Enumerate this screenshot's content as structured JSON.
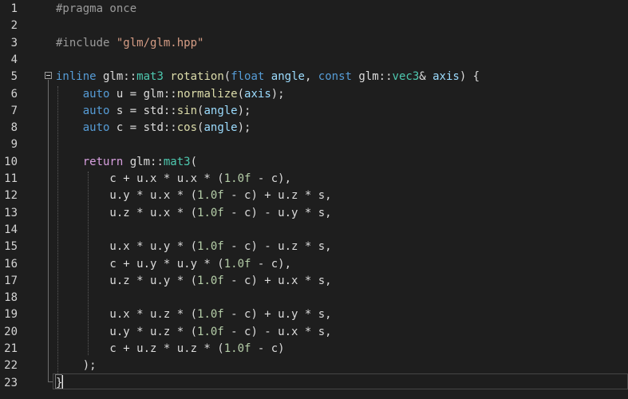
{
  "colors": {
    "background": "#1e1e1e",
    "default": "#dcdcdc",
    "preprocessor": "#9b9b9b",
    "string": "#d69d85",
    "keyword": "#569cd6",
    "control": "#d8a0df",
    "type": "#4ec9b0",
    "function": "#dcdcaa",
    "parameter": "#9cdcfe",
    "number": "#b5cea8"
  },
  "editor": {
    "lines": [
      {
        "n": "1",
        "tokens": [
          {
            "t": "#pragma once",
            "c": "preprocessor"
          }
        ]
      },
      {
        "n": "2",
        "tokens": []
      },
      {
        "n": "3",
        "tokens": [
          {
            "t": "#include ",
            "c": "preprocessor"
          },
          {
            "t": "\"glm/glm.hpp\"",
            "c": "string"
          }
        ]
      },
      {
        "n": "4",
        "tokens": []
      },
      {
        "n": "5",
        "tokens": [
          {
            "t": "inline",
            "c": "keyword"
          },
          {
            "t": " glm::",
            "c": "default"
          },
          {
            "t": "mat3",
            "c": "type"
          },
          {
            "t": " ",
            "c": "default"
          },
          {
            "t": "rotation",
            "c": "function"
          },
          {
            "t": "(",
            "c": "default"
          },
          {
            "t": "float",
            "c": "keyword"
          },
          {
            "t": " ",
            "c": "default"
          },
          {
            "t": "angle",
            "c": "parameter"
          },
          {
            "t": ", ",
            "c": "default"
          },
          {
            "t": "const",
            "c": "keyword"
          },
          {
            "t": " glm::",
            "c": "default"
          },
          {
            "t": "vec3",
            "c": "type"
          },
          {
            "t": "& ",
            "c": "default"
          },
          {
            "t": "axis",
            "c": "parameter"
          },
          {
            "t": ") {",
            "c": "default"
          }
        ]
      },
      {
        "n": "6",
        "tokens": [
          {
            "t": "    ",
            "c": "default"
          },
          {
            "t": "auto",
            "c": "keyword"
          },
          {
            "t": " u = glm::",
            "c": "default"
          },
          {
            "t": "normalize",
            "c": "function"
          },
          {
            "t": "(",
            "c": "default"
          },
          {
            "t": "axis",
            "c": "parameter"
          },
          {
            "t": ");",
            "c": "default"
          }
        ]
      },
      {
        "n": "7",
        "tokens": [
          {
            "t": "    ",
            "c": "default"
          },
          {
            "t": "auto",
            "c": "keyword"
          },
          {
            "t": " s = std::",
            "c": "default"
          },
          {
            "t": "sin",
            "c": "function"
          },
          {
            "t": "(",
            "c": "default"
          },
          {
            "t": "angle",
            "c": "parameter"
          },
          {
            "t": ");",
            "c": "default"
          }
        ]
      },
      {
        "n": "8",
        "tokens": [
          {
            "t": "    ",
            "c": "default"
          },
          {
            "t": "auto",
            "c": "keyword"
          },
          {
            "t": " c = std::",
            "c": "default"
          },
          {
            "t": "cos",
            "c": "function"
          },
          {
            "t": "(",
            "c": "default"
          },
          {
            "t": "angle",
            "c": "parameter"
          },
          {
            "t": ");",
            "c": "default"
          }
        ]
      },
      {
        "n": "9",
        "tokens": []
      },
      {
        "n": "10",
        "tokens": [
          {
            "t": "    ",
            "c": "default"
          },
          {
            "t": "return",
            "c": "control"
          },
          {
            "t": " glm::",
            "c": "default"
          },
          {
            "t": "mat3",
            "c": "type"
          },
          {
            "t": "(",
            "c": "default"
          }
        ]
      },
      {
        "n": "11",
        "tokens": [
          {
            "t": "        c + u.x * u.x * (",
            "c": "default"
          },
          {
            "t": "1.0f",
            "c": "number"
          },
          {
            "t": " - c),",
            "c": "default"
          }
        ]
      },
      {
        "n": "12",
        "tokens": [
          {
            "t": "        u.y * u.x * (",
            "c": "default"
          },
          {
            "t": "1.0f",
            "c": "number"
          },
          {
            "t": " - c) + u.z * s,",
            "c": "default"
          }
        ]
      },
      {
        "n": "13",
        "tokens": [
          {
            "t": "        u.z * u.x * (",
            "c": "default"
          },
          {
            "t": "1.0f",
            "c": "number"
          },
          {
            "t": " - c) - u.y * s,",
            "c": "default"
          }
        ]
      },
      {
        "n": "14",
        "tokens": []
      },
      {
        "n": "15",
        "tokens": [
          {
            "t": "        u.x * u.y * (",
            "c": "default"
          },
          {
            "t": "1.0f",
            "c": "number"
          },
          {
            "t": " - c) - u.z * s,",
            "c": "default"
          }
        ]
      },
      {
        "n": "16",
        "tokens": [
          {
            "t": "        c + u.y * u.y * (",
            "c": "default"
          },
          {
            "t": "1.0f",
            "c": "number"
          },
          {
            "t": " - c),",
            "c": "default"
          }
        ]
      },
      {
        "n": "17",
        "tokens": [
          {
            "t": "        u.z * u.y * (",
            "c": "default"
          },
          {
            "t": "1.0f",
            "c": "number"
          },
          {
            "t": " - c) + u.x * s,",
            "c": "default"
          }
        ]
      },
      {
        "n": "18",
        "tokens": []
      },
      {
        "n": "19",
        "tokens": [
          {
            "t": "        u.x * u.z * (",
            "c": "default"
          },
          {
            "t": "1.0f",
            "c": "number"
          },
          {
            "t": " - c) + u.y * s,",
            "c": "default"
          }
        ]
      },
      {
        "n": "20",
        "tokens": [
          {
            "t": "        u.y * u.z * (",
            "c": "default"
          },
          {
            "t": "1.0f",
            "c": "number"
          },
          {
            "t": " - c) - u.x * s,",
            "c": "default"
          }
        ]
      },
      {
        "n": "21",
        "tokens": [
          {
            "t": "        c + u.z * u.z * (",
            "c": "default"
          },
          {
            "t": "1.0f",
            "c": "number"
          },
          {
            "t": " - c)",
            "c": "default"
          }
        ]
      },
      {
        "n": "22",
        "tokens": [
          {
            "t": "    );",
            "c": "default"
          }
        ]
      },
      {
        "n": "23",
        "tokens": [
          {
            "t": "}",
            "c": "default"
          }
        ]
      }
    ]
  }
}
